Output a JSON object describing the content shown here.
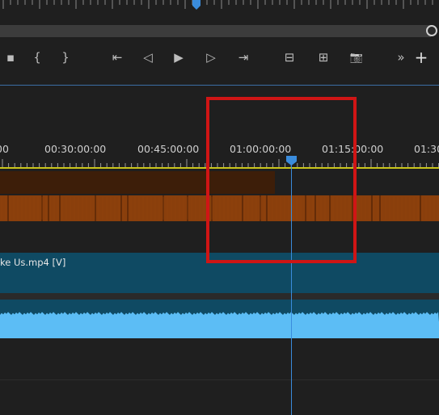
{
  "monitor": {
    "ruler_icon": "ruler-ticks",
    "playhead_icon": "playhead-marker"
  },
  "transport": {
    "buttons": [
      {
        "name": "lift-button",
        "glyph": "▪"
      },
      {
        "name": "mark-in-button",
        "glyph": "{"
      },
      {
        "name": "mark-out-button",
        "glyph": "}"
      },
      {
        "name": "go-to-in-button",
        "glyph": "⇤"
      },
      {
        "name": "step-back-button",
        "glyph": "◁"
      },
      {
        "name": "play-button",
        "glyph": "▶"
      },
      {
        "name": "step-forward-button",
        "glyph": "▷"
      },
      {
        "name": "go-to-out-button",
        "glyph": "⇥"
      },
      {
        "name": "lift-extract-button",
        "glyph": "⊟"
      },
      {
        "name": "extract-button",
        "glyph": "⊞"
      },
      {
        "name": "export-frame-button",
        "glyph": "📷"
      },
      {
        "name": "more-button",
        "glyph": "»"
      },
      {
        "name": "add-button",
        "glyph": "+"
      }
    ]
  },
  "timeline": {
    "timecodes": [
      "00",
      "00:30:00:00",
      "00:45:00:00",
      "01:00:00:00",
      "01:15:00:00",
      "01:30"
    ],
    "video_clip_label": "ke Us.mp4 [V]"
  },
  "colors": {
    "accent": "#3a8cdc",
    "video_clip": "#0f4a63",
    "audio_selected": "#5cbdf5",
    "orange_track": "#8a3f0c",
    "highlight": "#d01515"
  }
}
